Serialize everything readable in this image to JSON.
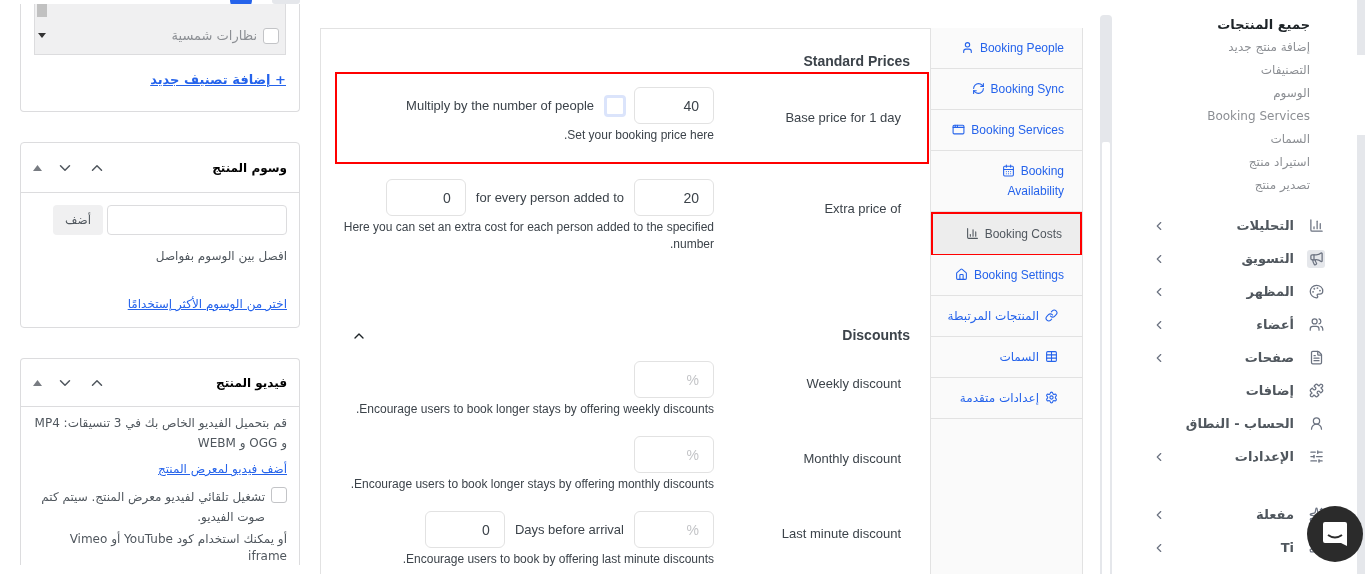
{
  "categories_box": {
    "items": [
      {
        "label": "نظارات شمسية",
        "checked": false
      }
    ],
    "add_link": "+ إضافة تصنيف جديد"
  },
  "tags_box": {
    "title": "وسوم المنتج",
    "add_button": "أضف",
    "hint": "افصل بين الوسوم بفواصل",
    "link": "اختر من الوسوم الأكثر إستخدامًا"
  },
  "video_box": {
    "title": "فيديو المنتج",
    "description": "قم بتحميل الفيديو الخاص بك في 3 تنسيقات: MP4 و OGG و WEBM",
    "link": "أضف فيديو لمعرض المنتج",
    "autoplay": {
      "label": "تشغيل تلقائي لفيديو معرض المنتج. سيتم كتم صوت الفيديو.",
      "checked": false
    },
    "embed_note": "أو يمكنك استخدام كود YouTube أو Vimeo iframe"
  },
  "standard_prices": {
    "title": "Standard Prices",
    "rows": [
      {
        "label": "Base price for 1 day",
        "highlighted": true,
        "controls": [
          {
            "kind": "input",
            "value": "40"
          },
          {
            "kind": "checkbox",
            "checked": false
          },
          {
            "kind": "text",
            "text": "Multiply by the number of people"
          }
        ],
        "hint": "Set your booking price here."
      },
      {
        "label": "Extra price of",
        "highlighted": false,
        "controls": [
          {
            "kind": "input",
            "value": "20"
          },
          {
            "kind": "text",
            "text": "for every person added to"
          },
          {
            "kind": "input",
            "value": "0"
          }
        ],
        "hint": "Here you can set an extra cost for each person added to the specified number."
      }
    ]
  },
  "discounts": {
    "title": "Discounts",
    "expanded": true,
    "rows": [
      {
        "label": "Weekly discount",
        "highlighted": false,
        "controls": [
          {
            "kind": "input",
            "placeholder": "%"
          }
        ],
        "hint": "Encourage users to book longer stays by offering weekly discounts."
      },
      {
        "label": "Monthly discount",
        "highlighted": false,
        "controls": [
          {
            "kind": "input",
            "placeholder": "%"
          }
        ],
        "hint": "Encourage users to book longer stays by offering monthly discounts."
      },
      {
        "label": "Last minute discount",
        "highlighted": false,
        "controls": [
          {
            "kind": "input",
            "placeholder": "%"
          },
          {
            "kind": "text",
            "text": "Days before arrival"
          },
          {
            "kind": "input",
            "value": "0"
          }
        ],
        "hint": "Encourage users to book by offering last minute discounts."
      }
    ]
  },
  "tabs": [
    {
      "label": "Booking People",
      "selected": false
    },
    {
      "label": "Booking Sync",
      "selected": false
    },
    {
      "label": "Booking Services",
      "selected": false
    },
    {
      "label": "Booking Availability",
      "selected": false
    },
    {
      "label": "Booking Costs",
      "selected": true
    },
    {
      "label": "Booking Settings",
      "selected": false
    },
    {
      "label": "المنتجات المرتبطة",
      "selected": false
    },
    {
      "label": "السمات",
      "selected": false
    },
    {
      "label": "إعدادات متقدمة",
      "selected": false
    }
  ],
  "sidebar": {
    "submenu": [
      {
        "label": "جميع المنتجات",
        "selected": true
      },
      {
        "label": "إضافة منتج جديد",
        "selected": false
      },
      {
        "label": "التصنيفات",
        "selected": false
      },
      {
        "label": "الوسوم",
        "selected": false
      },
      {
        "label": "Booking Services",
        "selected": false
      },
      {
        "label": "السمات",
        "selected": false
      },
      {
        "label": "استيراد منتج",
        "selected": false
      },
      {
        "label": "تصدير منتج",
        "selected": false
      }
    ],
    "menu": [
      {
        "label": "التحليلات",
        "has_submenu": true
      },
      {
        "label": "التسويق",
        "has_submenu": true
      },
      {
        "label": "المظهر",
        "has_submenu": true
      },
      {
        "label": "أعضاء",
        "has_submenu": true
      },
      {
        "label": "صفحات",
        "has_submenu": true
      },
      {
        "label": "إضافات",
        "has_submenu": false
      },
      {
        "label": "الحساب - النطاق",
        "has_submenu": false
      },
      {
        "label": "الإعدادات",
        "has_submenu": true
      }
    ],
    "menu_lower": [
      {
        "label": "مفعلة",
        "has_submenu": true
      },
      {
        "label": "Ti",
        "has_submenu": true
      }
    ]
  }
}
